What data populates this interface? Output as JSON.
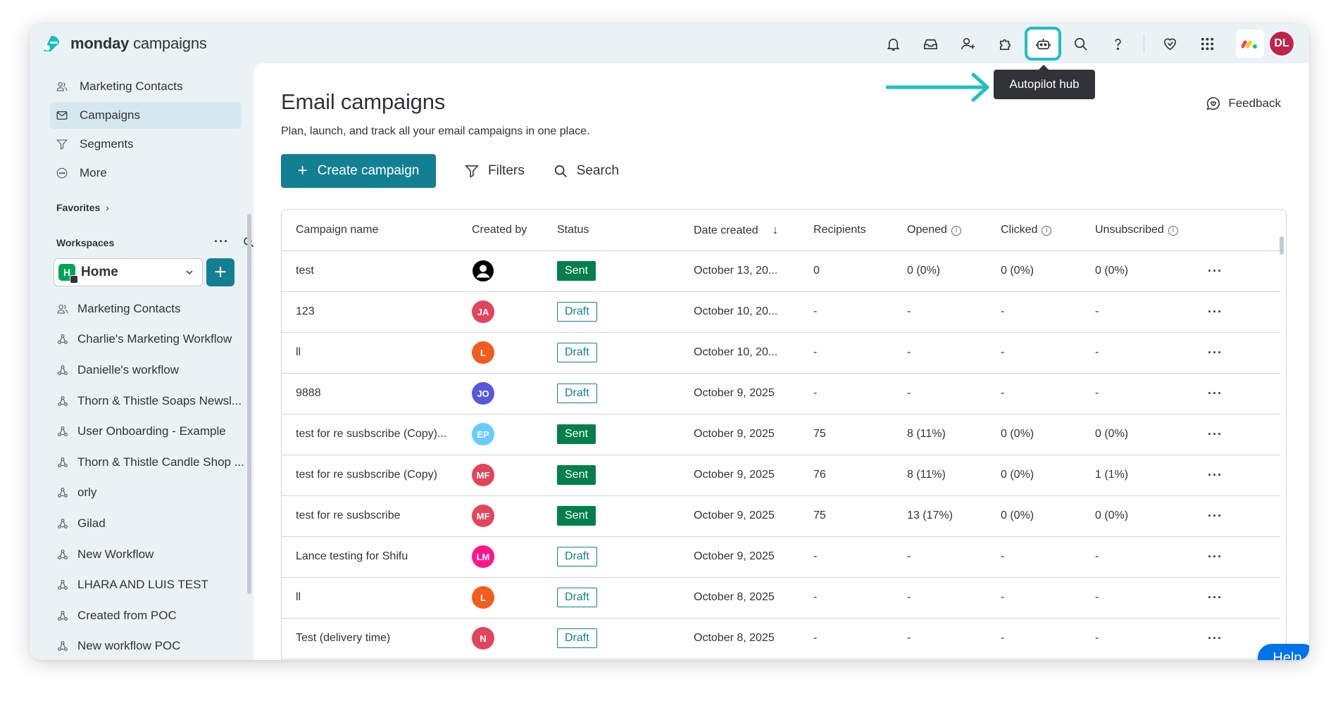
{
  "app": {
    "logo_bold": "monday",
    "logo_rest": " campaigns"
  },
  "header": {
    "icons": [
      "bell-icon",
      "inbox-icon",
      "invite-members-icon",
      "integrations-icon",
      "autopilot-icon",
      "search-icon",
      "help-question-icon",
      "heart-icon",
      "apps-grid-icon"
    ],
    "user_initials": "DL",
    "tooltip": "Autopilot hub"
  },
  "sidebar": {
    "nav": [
      {
        "label": "Marketing Contacts",
        "icon": "contacts-icon"
      },
      {
        "label": "Campaigns",
        "icon": "envelope-icon",
        "active": true
      },
      {
        "label": "Segments",
        "icon": "funnel-icon"
      },
      {
        "label": "More",
        "icon": "more-icon"
      }
    ],
    "favorites_label": "Favorites",
    "workspaces_label": "Workspaces",
    "workspace": {
      "badge": "H",
      "name": "Home"
    },
    "boards": [
      {
        "label": "Marketing Contacts",
        "icon": "contacts-icon"
      },
      {
        "label": "Charlie's Marketing Workflow",
        "icon": "workflow-icon"
      },
      {
        "label": "Danielle's workflow",
        "icon": "workflow-icon"
      },
      {
        "label": "Thorn & Thistle Soaps Newsl...",
        "icon": "workflow-icon"
      },
      {
        "label": "User Onboarding - Example",
        "icon": "workflow-icon"
      },
      {
        "label": "Thorn & Thistle Candle Shop ...",
        "icon": "workflow-icon"
      },
      {
        "label": "orly",
        "icon": "workflow-icon"
      },
      {
        "label": "Gilad",
        "icon": "workflow-icon"
      },
      {
        "label": "New Workflow",
        "icon": "workflow-icon"
      },
      {
        "label": "LHARA AND LUIS TEST",
        "icon": "workflow-icon"
      },
      {
        "label": "Created from POC",
        "icon": "workflow-icon"
      },
      {
        "label": "New workflow POC",
        "icon": "workflow-icon"
      }
    ]
  },
  "main": {
    "title": "Email campaigns",
    "subtitle": "Plan, launch, and track all your email campaigns in one place.",
    "feedback_label": "Feedback",
    "create_label": "Create campaign",
    "filters_label": "Filters",
    "search_label": "Search",
    "columns": [
      "Campaign name",
      "Created by",
      "Status",
      "Date created",
      "Recipients",
      "Opened",
      "Clicked",
      "Unsubscribed"
    ],
    "rows": [
      {
        "name": "test",
        "creator": "",
        "creator_color": "#ffffff",
        "status": "Sent",
        "date": "October 13, 20...",
        "recipients": "0",
        "opened": "0 (0%)",
        "clicked": "0 (0%)",
        "unsubscribed": "0 (0%)"
      },
      {
        "name": "123",
        "creator": "JA",
        "creator_color": "#e2445c",
        "status": "Draft",
        "date": "October 10, 20...",
        "recipients": "-",
        "opened": "-",
        "clicked": "-",
        "unsubscribed": "-"
      },
      {
        "name": "ll",
        "creator": "L",
        "creator_color": "#f25c1f",
        "status": "Draft",
        "date": "October 10, 20...",
        "recipients": "-",
        "opened": "-",
        "clicked": "-",
        "unsubscribed": "-"
      },
      {
        "name": "9888",
        "creator": "JO",
        "creator_color": "#5559df",
        "status": "Draft",
        "date": "October 9, 2025",
        "recipients": "-",
        "opened": "-",
        "clicked": "-",
        "unsubscribed": "-"
      },
      {
        "name": "test for re susbscribe (Copy)...",
        "creator": "EP",
        "creator_color": "#66ccff",
        "status": "Sent",
        "date": "October 9, 2025",
        "recipients": "75",
        "opened": "8 (11%)",
        "clicked": "0 (0%)",
        "unsubscribed": "0 (0%)"
      },
      {
        "name": "test for re susbscribe (Copy)",
        "creator": "MF",
        "creator_color": "#e2445c",
        "status": "Sent",
        "date": "October 9, 2025",
        "recipients": "76",
        "opened": "8 (11%)",
        "clicked": "0 (0%)",
        "unsubscribed": "1 (1%)"
      },
      {
        "name": "test for re susbscribe",
        "creator": "MF",
        "creator_color": "#e2445c",
        "status": "Sent",
        "date": "October 9, 2025",
        "recipients": "75",
        "opened": "13 (17%)",
        "clicked": "0 (0%)",
        "unsubscribed": "0 (0%)"
      },
      {
        "name": "Lance testing for Shifu",
        "creator": "LM",
        "creator_color": "#ff158a",
        "status": "Draft",
        "date": "October 9, 2025",
        "recipients": "-",
        "opened": "-",
        "clicked": "-",
        "unsubscribed": "-"
      },
      {
        "name": "ll",
        "creator": "L",
        "creator_color": "#f25c1f",
        "status": "Draft",
        "date": "October 8, 2025",
        "recipients": "-",
        "opened": "-",
        "clicked": "-",
        "unsubscribed": "-"
      },
      {
        "name": "Test (delivery time)",
        "creator": "N",
        "creator_color": "#e2445c",
        "status": "Draft",
        "date": "October 8, 2025",
        "recipients": "-",
        "opened": "-",
        "clicked": "-",
        "unsubscribed": "-"
      }
    ]
  },
  "help_label": "Help",
  "colors": {
    "accent": "#137f92",
    "sent": "#037f4c",
    "highlight": "#1fbfc4",
    "help": "#0073ea"
  }
}
